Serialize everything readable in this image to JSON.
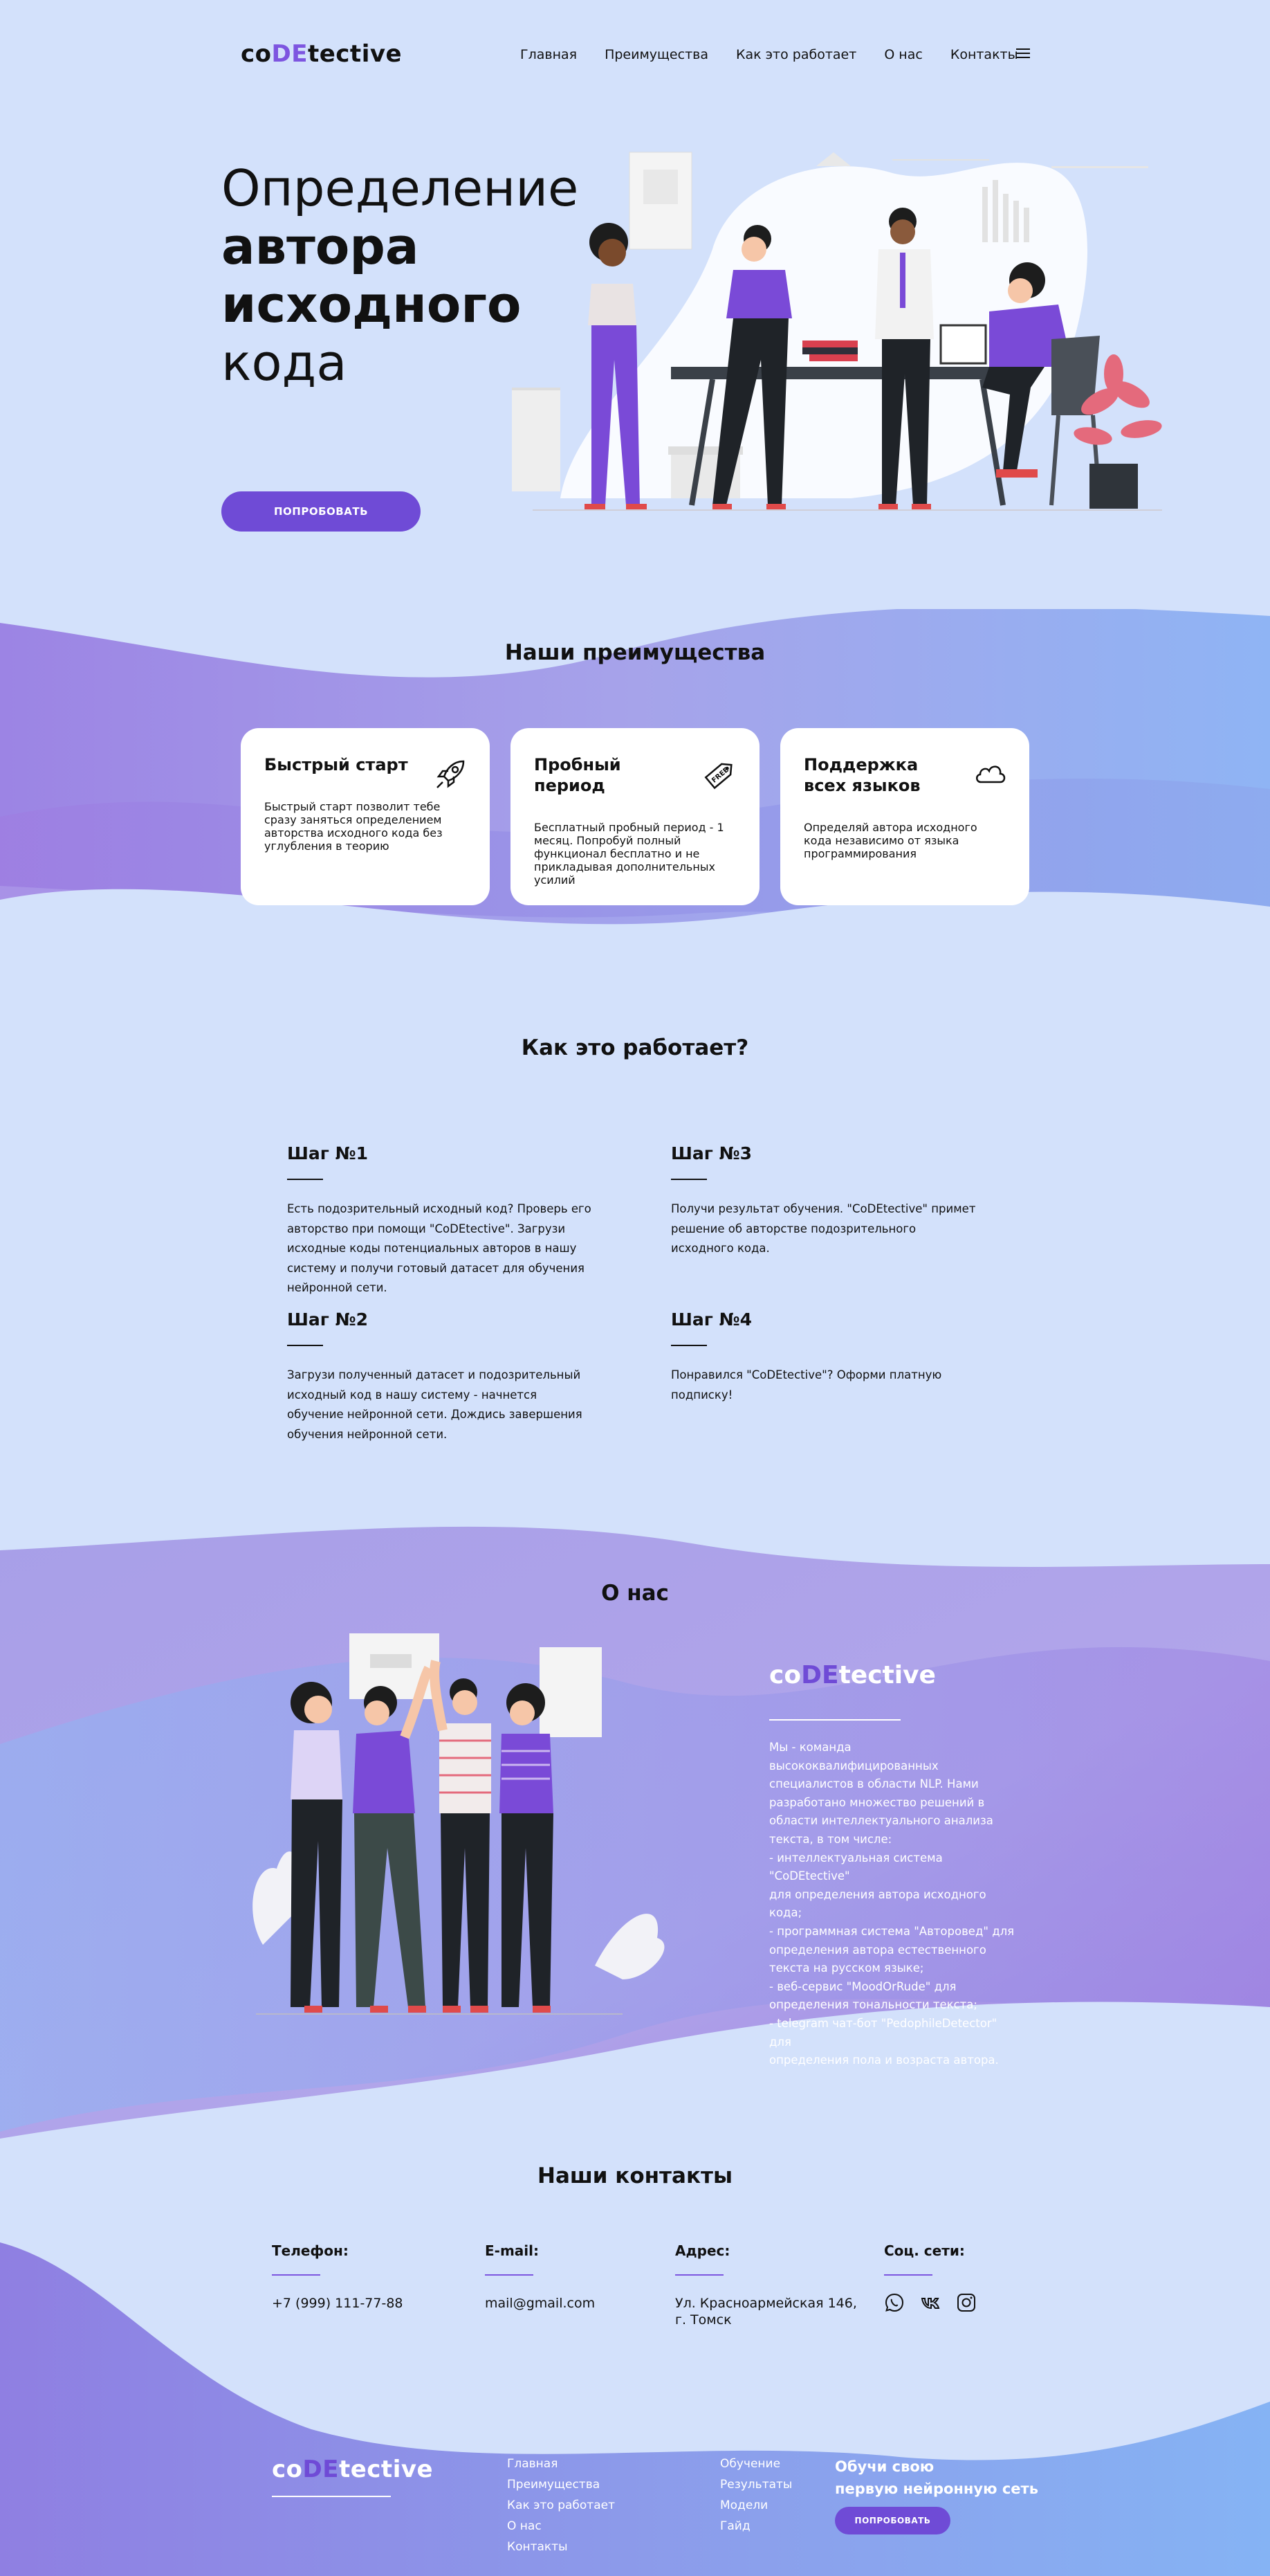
{
  "header": {
    "logo": {
      "pre": "co",
      "mid": "DE",
      "post": "tective"
    },
    "nav": [
      "Главная",
      "Преимущества",
      "Как это работает",
      "О нас",
      "Контакты"
    ]
  },
  "hero": {
    "title_line1": "Определение",
    "title_line2": "автора",
    "title_line3": "исходного",
    "title_line4": "кода",
    "cta": "ПОПРОБОВАТЬ"
  },
  "advantages": {
    "title": "Наши преимущества",
    "cards": [
      {
        "title": "Быстрый старт",
        "icon": "rocket-icon",
        "text": "Быстрый старт позволит тебе сразу заняться определением авторства исходного кода без углубления в теорию"
      },
      {
        "title": "Пробный период",
        "icon": "free-tag-icon",
        "text": "Бесплатный пробный период - 1 месяц. Попробуй полный функционал бесплатно и не прикладывая дополнительных усилий"
      },
      {
        "title": "Поддержка всех языков",
        "icon": "cloud-icon",
        "text": "Определяй автора исходного кода независимо от языка программирования"
      }
    ]
  },
  "how": {
    "title": "Как это работает?",
    "steps": [
      {
        "title": "Шаг №1",
        "text": "Есть подозрительный исходный код? Проверь его авторство при помощи \"CoDEtective\". Загрузи исходные коды потенциальных авторов в нашу систему и получи готовый датасет для обучения нейронной сети."
      },
      {
        "title": "Шаг №3",
        "text": "Получи результат обучения. \"CoDEtective\" примет решение об авторстве подозрительного исходного кода."
      },
      {
        "title": "Шаг №2",
        "text": "Загрузи полученный датасет и подозрительный исходный код в нашу систему - начнется обучение нейронной сети. Дождись завершения обучения нейронной сети."
      },
      {
        "title": "Шаг №4",
        "text": "Понравился \"CoDEtective\"? Оформи платную подписку!"
      }
    ]
  },
  "about": {
    "title": "О нас",
    "logo": {
      "pre": "co",
      "mid": "DE",
      "post": "tective"
    },
    "lines": [
      "Мы - команда высококвалифицированных",
      "специалистов в области NLP. Нами",
      "разработано множество решений в",
      "области интеллектуального анализа",
      "текста, в том числе:",
      "- интеллектуальная система \"CoDEtective\"",
      "для определения автора исходного кода;",
      "- программная система \"Авторовед\" для",
      "определения автора естественного",
      "текста на русском языке;",
      "- веб-сервис \"MoodOrRude\" для",
      "определения тональности текста;",
      "- telegram чат-бот \"PedophileDetector\" для",
      "определения пола и возраста автора."
    ]
  },
  "contacts": {
    "title": "Наши контакты",
    "phone_label": "Телефон:",
    "phone": "+7 (999) 111-77-88",
    "email_label": "E-mail:",
    "email": "mail@gmail.com",
    "address_label": "Адрес:",
    "address_line1": "Ул. Красноармейская 146,",
    "address_line2": "г. Томск",
    "social_label": "Соц. сети:",
    "social_icons": [
      "whatsapp-icon",
      "vk-icon",
      "instagram-icon"
    ]
  },
  "footer": {
    "logo": {
      "pre": "co",
      "mid": "DE",
      "post": "tective"
    },
    "col1": [
      "Главная",
      "Преимущества",
      "Как это работает",
      "О нас",
      "Контакты"
    ],
    "col2": [
      "Обучение",
      "Результаты",
      "Модели",
      "Гайд"
    ],
    "cta_line1": "Обучи свою",
    "cta_line2": "первую нейронную сеть",
    "cta_button": "ПОПРОБОВАТЬ"
  },
  "colors": {
    "background": "#d3e1fb",
    "accent": "#6f4bd6",
    "logo_accent": "#7d55e0"
  }
}
